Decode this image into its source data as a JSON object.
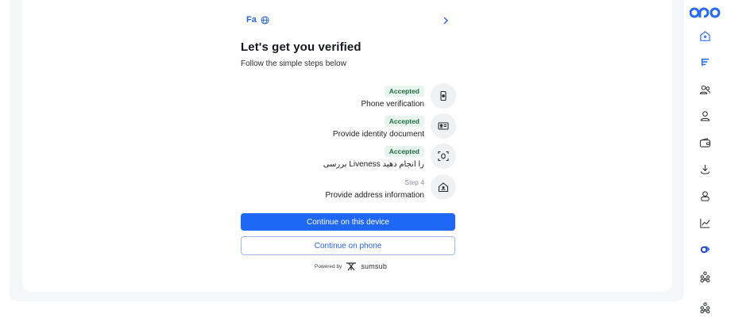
{
  "header": {
    "language_label": "Fa"
  },
  "verification": {
    "title": "Let's get you verified",
    "subtitle": "Follow the simple steps below",
    "steps": [
      {
        "status": "Accepted",
        "label": "Phone verification",
        "icon": "phone-icon"
      },
      {
        "status": "Accepted",
        "label": "Provide identity document",
        "icon": "id-card-icon"
      },
      {
        "status": "Accepted",
        "label": "بررسی Liveness را انجام دهید",
        "icon": "face-scan-icon"
      },
      {
        "status": "Step 4",
        "label": "Provide address information",
        "icon": "home-icon"
      }
    ],
    "primary_button": "Continue on this device",
    "secondary_button": "Continue on phone",
    "powered_by": "Powered by",
    "provider": "sumsub"
  },
  "sidebar": {
    "icons": [
      "home-icon",
      "stream-icon",
      "users-icon",
      "user-icon",
      "wallet-icon",
      "download-icon",
      "profile-icon",
      "chart-line-icon",
      "exchange-icon",
      "network-icon",
      "network-icon"
    ]
  },
  "colors": {
    "primary": "#1f67f5",
    "accepted_bg": "#e8f5ee",
    "accepted_text": "#1f6b43",
    "link": "#2a62d8"
  }
}
